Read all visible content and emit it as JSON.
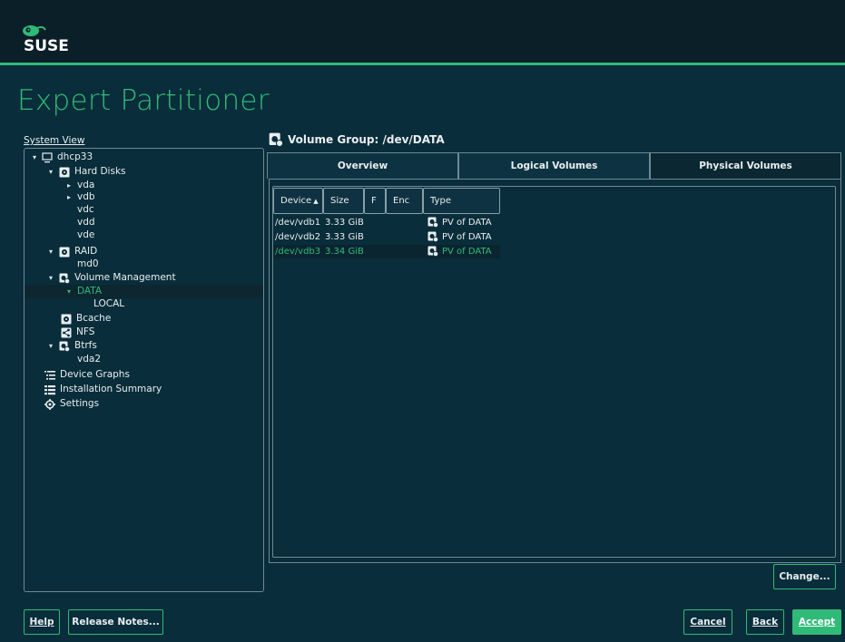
{
  "brand": {
    "logo_text": "SUSE",
    "accent": "#30ba78"
  },
  "page": {
    "title": "Expert Partitioner"
  },
  "system_view": {
    "label": "System View",
    "tree": [
      {
        "label": "dhcp33",
        "icon": "computer-icon",
        "expander": "expanded"
      },
      {
        "label": "Hard Disks",
        "icon": "hard-disk-icon",
        "expander": "expanded"
      },
      {
        "label": "vda",
        "icon": "",
        "expander": "collapsed"
      },
      {
        "label": "vdb",
        "icon": "",
        "expander": "collapsed"
      },
      {
        "label": "vdc",
        "icon": "",
        "expander": ""
      },
      {
        "label": "vdd",
        "icon": "",
        "expander": ""
      },
      {
        "label": "vde",
        "icon": "",
        "expander": ""
      },
      {
        "label": "RAID",
        "icon": "raid-icon",
        "expander": "expanded"
      },
      {
        "label": "md0",
        "icon": "",
        "expander": ""
      },
      {
        "label": "Volume Management",
        "icon": "volume-management-icon",
        "expander": "expanded"
      },
      {
        "label": "DATA",
        "icon": "",
        "expander": "expanded",
        "selected": true
      },
      {
        "label": "LOCAL",
        "icon": "",
        "expander": ""
      },
      {
        "label": "Bcache",
        "icon": "bcache-icon",
        "expander": ""
      },
      {
        "label": "NFS",
        "icon": "nfs-icon",
        "expander": ""
      },
      {
        "label": "Btrfs",
        "icon": "btrfs-icon",
        "expander": "expanded"
      },
      {
        "label": "vda2",
        "icon": "",
        "expander": ""
      },
      {
        "label": "Device Graphs",
        "icon": "device-graphs-icon",
        "expander": ""
      },
      {
        "label": "Installation Summary",
        "icon": "installation-summary-icon",
        "expander": ""
      },
      {
        "label": "Settings",
        "icon": "settings-gear-icon",
        "expander": ""
      }
    ]
  },
  "volume_group": {
    "header": "Volume Group: /dev/DATA",
    "tabs": [
      "Overview",
      "Logical Volumes",
      "Physical Volumes"
    ],
    "active_tab": "Physical Volumes",
    "table": {
      "columns": [
        "Device",
        "Size",
        "F",
        "Enc",
        "Type"
      ],
      "sort_indicator": "▲",
      "rows": [
        {
          "device": "/dev/vdb1",
          "size": "3.33 GiB",
          "f": "",
          "enc": "",
          "type": "PV of DATA"
        },
        {
          "device": "/dev/vdb2",
          "size": "3.33 GiB",
          "f": "",
          "enc": "",
          "type": "PV of DATA"
        },
        {
          "device": "/dev/vdb3",
          "size": "3.34 GiB",
          "f": "",
          "enc": "",
          "type": "PV of DATA",
          "selected": true
        }
      ]
    },
    "change_button": "Change..."
  },
  "footer": {
    "help": "Help",
    "release_notes": "Release Notes...",
    "cancel": "Cancel",
    "back": "Back",
    "accept": "Accept"
  }
}
